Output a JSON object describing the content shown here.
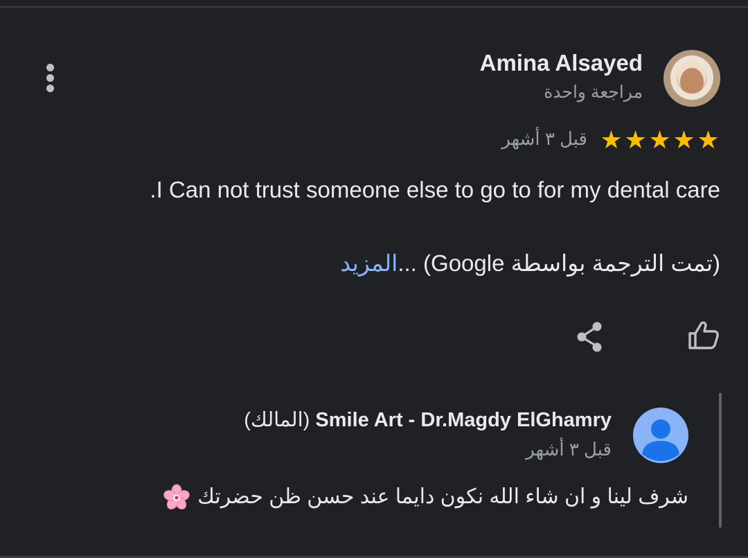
{
  "review": {
    "reviewer_name": "Amina Alsayed",
    "reviewer_meta": "مراجعة واحدة",
    "rating": 5,
    "rating_max": 5,
    "star_glyph": "★",
    "date": "قبل ٣ أشهر",
    "text": "I Can not trust someone else to go to for my dental care.",
    "translation_note": "(تمت الترجمة بواسطة Google)",
    "ellipsis": " ...",
    "more_label": "المزيد"
  },
  "actions": {
    "like_icon": "thumb-up-icon",
    "share_icon": "share-icon",
    "menu_icon": "more-vert-icon"
  },
  "owner_reply": {
    "name": "Smile Art - Dr.Magdy ElGhamry",
    "role_label": "(المالك)",
    "date": "قبل ٣ أشهر",
    "text": "شرف لينا و ان شاء الله نكون دايما عند حسن ظن حضرتك",
    "emoji_icon": "cherry-blossom-icon"
  },
  "colors": {
    "background": "#202124",
    "text_primary": "#e8eaed",
    "text_secondary": "#9aa0a6",
    "star": "#fbbc04",
    "link": "#8ab4f8",
    "owner_avatar": "#8ab4f8"
  }
}
